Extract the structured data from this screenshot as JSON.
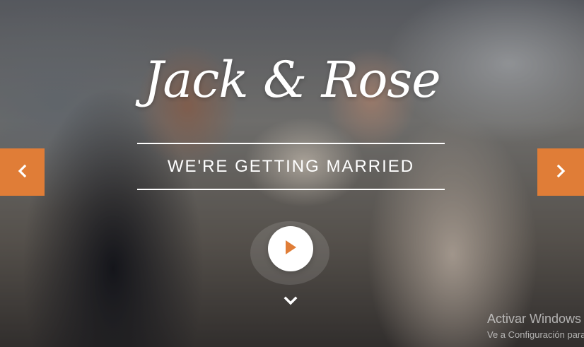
{
  "hero": {
    "couple_names": "Jack & Rose",
    "tagline": "WE'RE GETTING MARRIED",
    "accent_color": "#e07d37"
  },
  "controls": {
    "prev_icon": "chevron-left-icon",
    "next_icon": "chevron-right-icon",
    "play_icon": "play-icon",
    "scroll_icon": "chevron-down-icon"
  },
  "watermark": {
    "line1": "Activar Windows",
    "line2": "Ve a Configuración para activar Windows."
  }
}
